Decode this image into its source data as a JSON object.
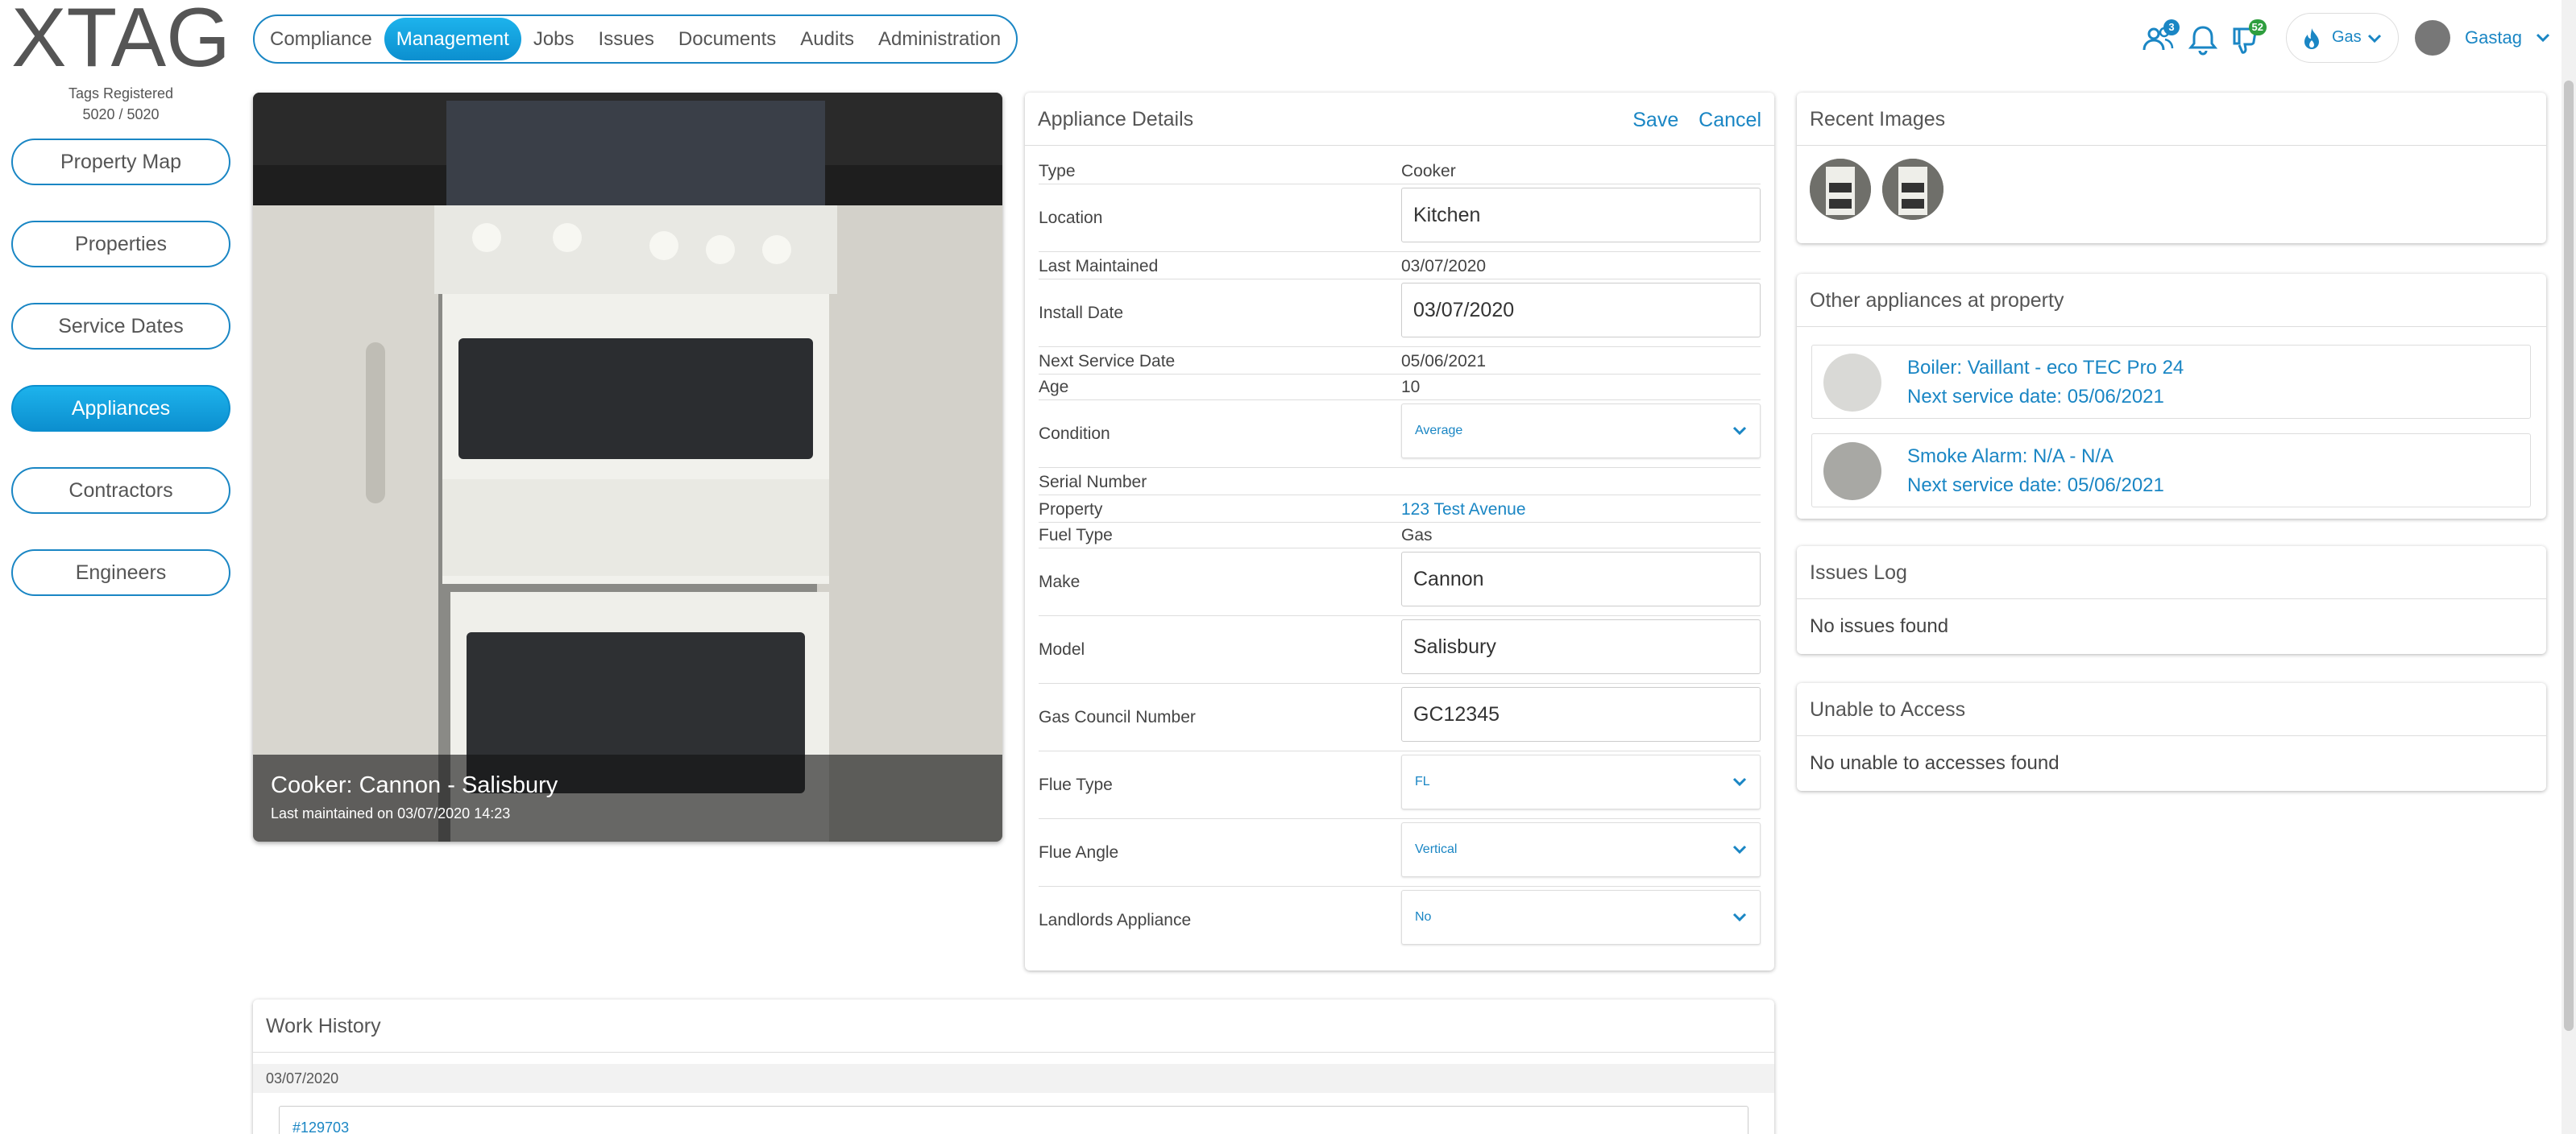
{
  "logo": {
    "text": "XTAG"
  },
  "tags": {
    "label": "Tags Registered",
    "count": "5020 / 5020"
  },
  "topnav": {
    "tabs": [
      {
        "label": "Compliance"
      },
      {
        "label": "Management",
        "active": true
      },
      {
        "label": "Jobs"
      },
      {
        "label": "Issues"
      },
      {
        "label": "Documents"
      },
      {
        "label": "Audits"
      },
      {
        "label": "Administration"
      }
    ]
  },
  "header": {
    "people_badge": "3",
    "alerts_badge": "52",
    "fuel_selector": "Gas",
    "user_name": "Gastag",
    "icons": [
      "people-icon",
      "bell-icon",
      "thumbs-down-icon",
      "flame-icon",
      "chevron-down-icon"
    ]
  },
  "sidenav": {
    "items": [
      {
        "label": "Property Map"
      },
      {
        "label": "Properties"
      },
      {
        "label": "Service Dates"
      },
      {
        "label": "Appliances",
        "active": true
      },
      {
        "label": "Contractors"
      },
      {
        "label": "Engineers"
      }
    ]
  },
  "photo": {
    "title": "Cooker: Cannon - Salisbury",
    "subtitle": "Last maintained on 03/07/2020 14:23"
  },
  "details": {
    "title": "Appliance Details",
    "save_label": "Save",
    "cancel_label": "Cancel",
    "type_label": "Type",
    "type_value": "Cooker",
    "location_label": "Location",
    "location_value": "Kitchen",
    "last_maintained_label": "Last Maintained",
    "last_maintained_value": "03/07/2020",
    "install_date_label": "Install Date",
    "install_date_value": "03/07/2020",
    "next_service_label": "Next Service Date",
    "next_service_value": "05/06/2021",
    "age_label": "Age",
    "age_value": "10",
    "condition_label": "Condition",
    "condition_value": "Average",
    "serial_label": "Serial Number",
    "serial_value": "",
    "property_label": "Property",
    "property_value": "123 Test Avenue",
    "fuel_label": "Fuel Type",
    "fuel_value": "Gas",
    "make_label": "Make",
    "make_value": "Cannon",
    "model_label": "Model",
    "model_value": "Salisbury",
    "gc_label": "Gas Council Number",
    "gc_value": "GC12345",
    "flue_type_label": "Flue Type",
    "flue_type_value": "FL",
    "flue_angle_label": "Flue Angle",
    "flue_angle_value": "Vertical",
    "landlords_label": "Landlords Appliance",
    "landlords_value": "No"
  },
  "recent_images": {
    "title": "Recent Images"
  },
  "other_appliances": {
    "title": "Other appliances at property",
    "items": [
      {
        "name": "Boiler: Vaillant - eco TEC Pro 24",
        "next": "Next service date: 05/06/2021"
      },
      {
        "name": "Smoke Alarm: N/A - N/A",
        "next": "Next service date: 05/06/2021"
      }
    ]
  },
  "issues_log": {
    "title": "Issues Log",
    "empty": "No issues found"
  },
  "unable_access": {
    "title": "Unable to Access",
    "empty": "No unable to accesses found"
  },
  "work_history": {
    "title": "Work History",
    "date": "03/07/2020",
    "item_number": "#129703"
  },
  "colors": {
    "accent": "#1a86c4",
    "accent_light": "#1db3ec",
    "badge_blue": "#1a86c4",
    "badge_green": "#2e9e3e"
  }
}
